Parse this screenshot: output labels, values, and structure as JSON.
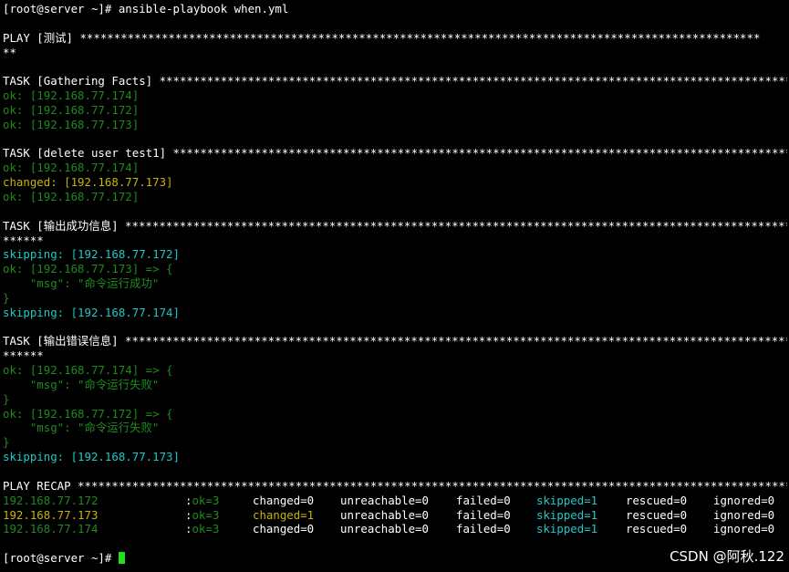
{
  "terminal": {
    "prompt": "[root@server ~]# ",
    "command": "ansible-playbook when.yml",
    "play_header": "PLAY [测试] ****************************************************************************************************",
    "play_header_cont": "**",
    "task1": {
      "header": "TASK [Gathering Facts] *********************************************************************************************************",
      "lines": [
        "ok: [192.168.77.174]",
        "ok: [192.168.77.172]",
        "ok: [192.168.77.173]"
      ]
    },
    "task2": {
      "header": "TASK [delete user test1] *******************************************************************************************************",
      "line1": "ok: [192.168.77.174]",
      "line2": "changed: [192.168.77.173]",
      "line3": "ok: [192.168.77.172]"
    },
    "task3": {
      "header": "TASK [输出成功信息] **************************************************************************************************",
      "header_cont": "******",
      "skip1": "skipping: [192.168.77.172]",
      "ok_open": "ok: [192.168.77.173] => {",
      "msg": "    \"msg\": \"命令运行成功\"",
      "close": "}",
      "skip2": "skipping: [192.168.77.174]"
    },
    "task4": {
      "header": "TASK [输出错误信息] **************************************************************************************************",
      "header_cont": "******",
      "ok1_open": "ok: [192.168.77.174] => {",
      "msg1": "    \"msg\": \"命令运行失败\"",
      "close1": "}",
      "ok2_open": "ok: [192.168.77.172] => {",
      "msg2": "    \"msg\": \"命令运行失败\"",
      "close2": "}",
      "skip": "skipping: [192.168.77.173]"
    },
    "recap_header": "PLAY RECAP *****************************************************************************************************************",
    "recap": [
      {
        "host": "192.168.77.172",
        "colon": ":",
        "ok": "ok=3",
        "changed": "changed=0",
        "unreachable": "unreachable=0",
        "failed": "failed=0",
        "skipped": "skipped=1",
        "rescued": "rescued=0",
        "ignored": "ignored=0"
      },
      {
        "host": "192.168.77.173",
        "colon": ":",
        "ok": "ok=3",
        "changed": "changed=1",
        "unreachable": "unreachable=0",
        "failed": "failed=0",
        "skipped": "skipped=1",
        "rescued": "rescued=0",
        "ignored": "ignored=0"
      },
      {
        "host": "192.168.77.174",
        "colon": ":",
        "ok": "ok=3",
        "changed": "changed=0",
        "unreachable": "unreachable=0",
        "failed": "failed=0",
        "skipped": "skipped=1",
        "rescued": "rescued=0",
        "ignored": "ignored=0"
      }
    ],
    "final_prompt": "[root@server ~]# "
  },
  "watermark": "CSDN @阿秋.122",
  "colors": {
    "background": "#000000",
    "ok": "#1e8a1e",
    "changed": "#c8b400",
    "skipping": "#1ec8c8",
    "cursor": "#20e020"
  }
}
